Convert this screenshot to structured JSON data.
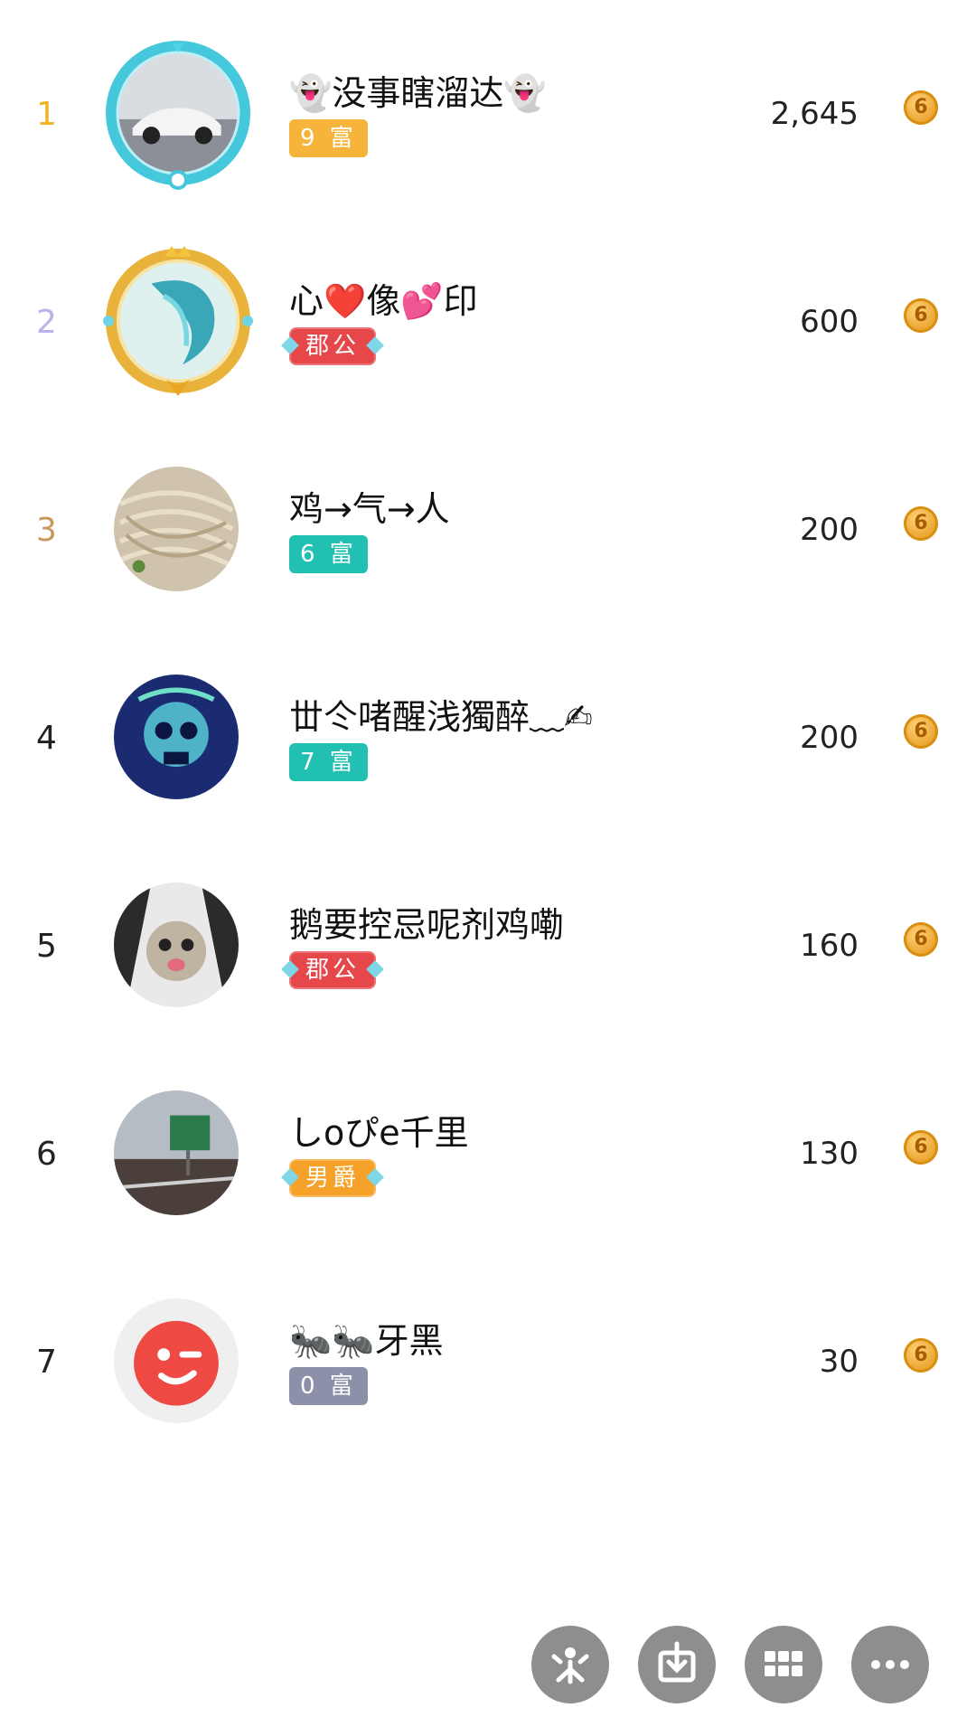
{
  "colors": {
    "rank1": "#f0b323",
    "rank2": "#b9b3ea",
    "rank3": "#c8975a",
    "rank_default": "#222222",
    "badge_rich_gold": "#f6b43a",
    "badge_rich_teal": "#22c0b3",
    "badge_rich_gray": "#8c90a8",
    "badge_noble_red": "#e5474b",
    "badge_noble_orange": "#f6a22a",
    "fab_gray": "#8e8e8e"
  },
  "entries": [
    {
      "rank": "1",
      "name": "👻没事瞎溜达👻",
      "badge": "9 富",
      "badge_kind": "rich",
      "badge_color": "#f6b43a",
      "score": "2,645",
      "avatar_icon": "sports-car-avatar"
    },
    {
      "rank": "2",
      "name": "心❤️像💕印",
      "badge": "郡公",
      "badge_kind": "noble",
      "badge_color": "#e5474b",
      "score": "600",
      "avatar_icon": "dragon-avatar"
    },
    {
      "rank": "3",
      "name": "鸡→气→人",
      "badge": "6 富",
      "badge_kind": "rich",
      "badge_color": "#22c0b3",
      "score": "200",
      "avatar_icon": "noodles-avatar"
    },
    {
      "rank": "4",
      "name": "丗仒啫醒浅獨醉﹏✍",
      "badge": "7 富",
      "badge_kind": "rich",
      "badge_color": "#22c0b3",
      "score": "200",
      "avatar_icon": "skull-avatar"
    },
    {
      "rank": "5",
      "name": "鹅要控忌呢剂鸡嘞",
      "badge": "郡公",
      "badge_kind": "noble",
      "badge_color": "#e5474b",
      "score": "160",
      "avatar_icon": "cat-avatar"
    },
    {
      "rank": "6",
      "name": "しoぴe千里",
      "badge": "男爵",
      "badge_kind": "noble",
      "badge_color": "#f6a22a",
      "score": "130",
      "avatar_icon": "road-sign-avatar"
    },
    {
      "rank": "7",
      "name": "🐜🐜牙黑",
      "badge": "0 富",
      "badge_kind": "rich",
      "badge_color": "#8c90a8",
      "score": "30",
      "avatar_icon": "winking-face-avatar"
    }
  ],
  "coin_symbol": "6",
  "fab_buttons": [
    {
      "icon": "sparkle-icon"
    },
    {
      "icon": "download-icon"
    },
    {
      "icon": "grid-icon"
    },
    {
      "icon": "more-icon"
    }
  ]
}
